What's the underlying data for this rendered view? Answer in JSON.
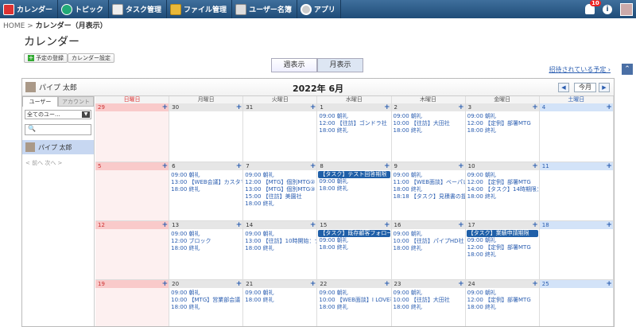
{
  "nav": {
    "items": [
      {
        "label": "カレンダー",
        "icon": "calendar-icon"
      },
      {
        "label": "トピック",
        "icon": "topic-icon"
      },
      {
        "label": "タスク管理",
        "icon": "task-icon"
      },
      {
        "label": "ファイル管理",
        "icon": "folder-icon"
      },
      {
        "label": "ユーザー名簿",
        "icon": "user-list-icon"
      },
      {
        "label": "アプリ",
        "icon": "app-icon"
      }
    ],
    "notification_count": "10",
    "info_glyph": "i"
  },
  "breadcrumb": {
    "home": "HOME",
    "sep": ">",
    "current": "カレンダー（月表示）"
  },
  "page_title": "カレンダー",
  "toolbar": {
    "add_schedule": "予定の登録",
    "settings": "カレンダー設定",
    "plus": "+"
  },
  "view": {
    "week": "週表示",
    "month": "月表示"
  },
  "invite_link": "招待されている予定 ›",
  "scroll_top": "⌃",
  "calendar": {
    "user_name": "パイプ 太郎",
    "month_title": "2022年 6月",
    "prev": "◀",
    "next": "▶",
    "today": "今月"
  },
  "sidebar": {
    "tab_user": "ユーザー",
    "tab_account": "アカウント",
    "select_value": "全てのユー...",
    "select_arrow": "▼",
    "search_icon_glyph": "🔍",
    "user_name": "パイプ 太郎",
    "pager": "< 前へ  次へ >"
  },
  "dow": [
    "日曜日",
    "月曜日",
    "火曜日",
    "水曜日",
    "木曜日",
    "金曜日",
    "土曜日"
  ],
  "weeks": [
    [
      {
        "date": "29",
        "events": []
      },
      {
        "date": "30",
        "events": []
      },
      {
        "date": "31",
        "events": []
      },
      {
        "date": "1",
        "events": [
          "09:00 朝礼",
          "12:00 【往訪】ゴンドラ社",
          "18:00 終礼"
        ]
      },
      {
        "date": "2",
        "events": [
          "09:00 朝礼",
          "10:00 【往訪】大田社",
          "18:00 終礼"
        ]
      },
      {
        "date": "3",
        "events": [
          "09:00 朝礼",
          "12:00 【定例】部署MTG",
          "18:00 終礼"
        ]
      },
      {
        "date": "4",
        "events": []
      }
    ],
    [
      {
        "date": "5",
        "events": []
      },
      {
        "date": "6",
        "events": [
          "09:00 朝礼",
          "13:00 【WEB会議】カスタマー",
          "18:00 終礼"
        ]
      },
      {
        "date": "7",
        "events": [
          "09:00 朝礼",
          "12:00 【MTG】個別MTG②",
          "13:00 【MTG】個別MTG③",
          "15:00 【往訪】美園社",
          "18:00 終礼"
        ]
      },
      {
        "date": "8",
        "task": "【タスク】テスト回答期限",
        "events": [
          "09:00 朝礼",
          "18:00 終礼"
        ]
      },
      {
        "date": "9",
        "events": [
          "09:00 朝礼",
          "11:00 【WEB面談】ベーパレス",
          "18:00 終礼",
          "18:18 【タスク】見積書の提出"
        ]
      },
      {
        "date": "10",
        "events": [
          "09:00 朝礼",
          "12:00 【定例】部署MTG",
          "14:00 【タスク】14時期限：指",
          "18:00 終礼"
        ]
      },
      {
        "date": "11",
        "events": []
      }
    ],
    [
      {
        "date": "12",
        "events": []
      },
      {
        "date": "13",
        "events": [
          "09:00 朝礼",
          "12:00 ブロック",
          "18:00 終礼"
        ]
      },
      {
        "date": "14",
        "events": [
          "09:00 朝礼",
          "13:00 【往訪】10時開始：ナ",
          "18:00 終礼"
        ]
      },
      {
        "date": "15",
        "task": "【タスク】既存顧客フォロー",
        "events": [
          "09:00 朝礼",
          "18:00 終礼"
        ]
      },
      {
        "date": "16",
        "events": [
          "09:00 朝礼",
          "10:00 【往訪】パイプHD社",
          "18:00 終礼"
        ]
      },
      {
        "date": "17",
        "task": "【タスク】業績申請期限",
        "events": [
          "09:00 朝礼",
          "12:00 【定例】部署MTG",
          "18:00 終礼"
        ]
      },
      {
        "date": "18",
        "events": []
      }
    ],
    [
      {
        "date": "19",
        "events": []
      },
      {
        "date": "20",
        "events": [
          "09:00 朝礼",
          "10:00 【MTG】営業部会議",
          "18:00 終礼"
        ]
      },
      {
        "date": "21",
        "events": [
          "09:00 朝礼",
          "18:00 終礼"
        ]
      },
      {
        "date": "22",
        "events": [
          "09:00 朝礼",
          "10:00 【WEB面談】I LOVE社",
          "18:00 終礼"
        ]
      },
      {
        "date": "23",
        "events": [
          "09:00 朝礼",
          "10:00 【往訪】大田社",
          "18:00 終礼"
        ]
      },
      {
        "date": "24",
        "events": [
          "09:00 朝礼",
          "12:00 【定例】部署MTG",
          "18:00 終礼"
        ]
      },
      {
        "date": "25",
        "events": []
      }
    ]
  ]
}
